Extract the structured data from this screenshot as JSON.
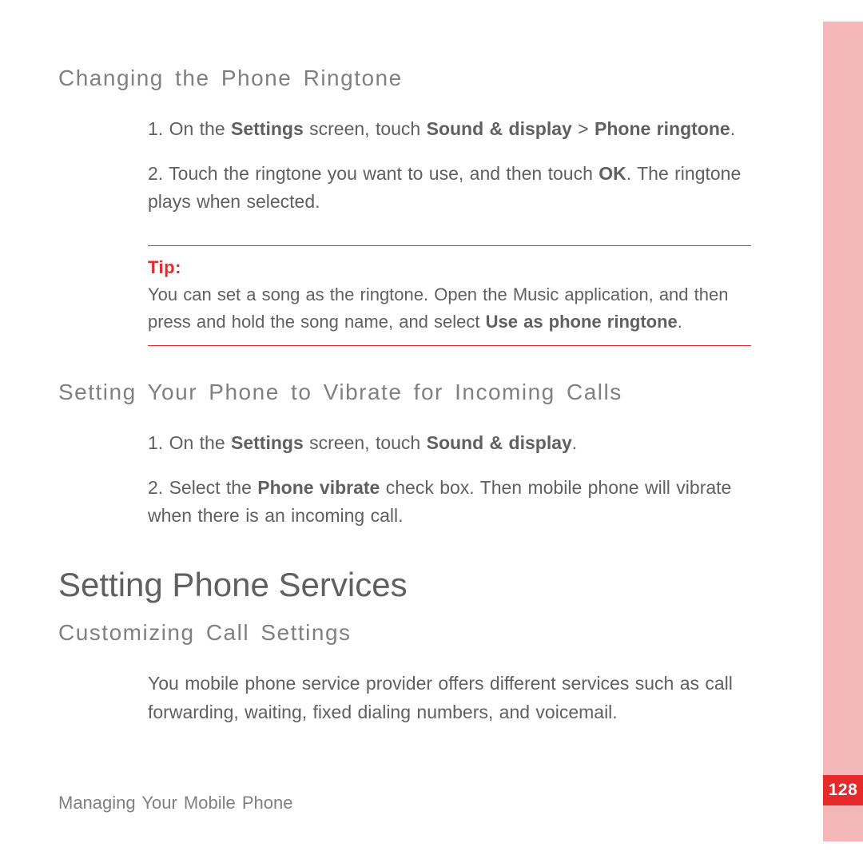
{
  "sections": {
    "s1": {
      "heading": "Changing the Phone Ringtone",
      "step1_pre": "1. On the ",
      "step1_b1": "Settings",
      "step1_mid1": " screen, touch ",
      "step1_b2": "Sound & display",
      "step1_mid2": " > ",
      "step1_b3": "Phone ringtone",
      "step1_post": ".",
      "step2_pre": "2. Touch the ringtone you want to use, and then touch ",
      "step2_b1": "OK",
      "step2_post": ". The ringtone plays when selected."
    },
    "tip": {
      "label": "Tip:",
      "text_pre": "You can set a song as the ringtone. Open the Music application, and then press and hold the song name, and select ",
      "text_b": "Use as phone ringtone",
      "text_post": "."
    },
    "s2": {
      "heading": "Setting Your Phone to Vibrate for Incoming Calls",
      "step1_pre": "1. On the ",
      "step1_b1": "Settings",
      "step1_mid1": " screen, touch ",
      "step1_b2": "Sound & display",
      "step1_post": ".",
      "step2_pre": "2. Select the ",
      "step2_b1": "Phone vibrate",
      "step2_post": " check box. Then mobile phone will vibrate when there is an incoming call."
    },
    "s3": {
      "title": "Setting Phone Services",
      "heading": "Customizing Call Settings",
      "para": "You mobile phone service provider offers different services such as call forwarding, waiting, fixed dialing numbers, and voicemail."
    }
  },
  "footer": "Managing Your Mobile Phone",
  "page_number": "128"
}
